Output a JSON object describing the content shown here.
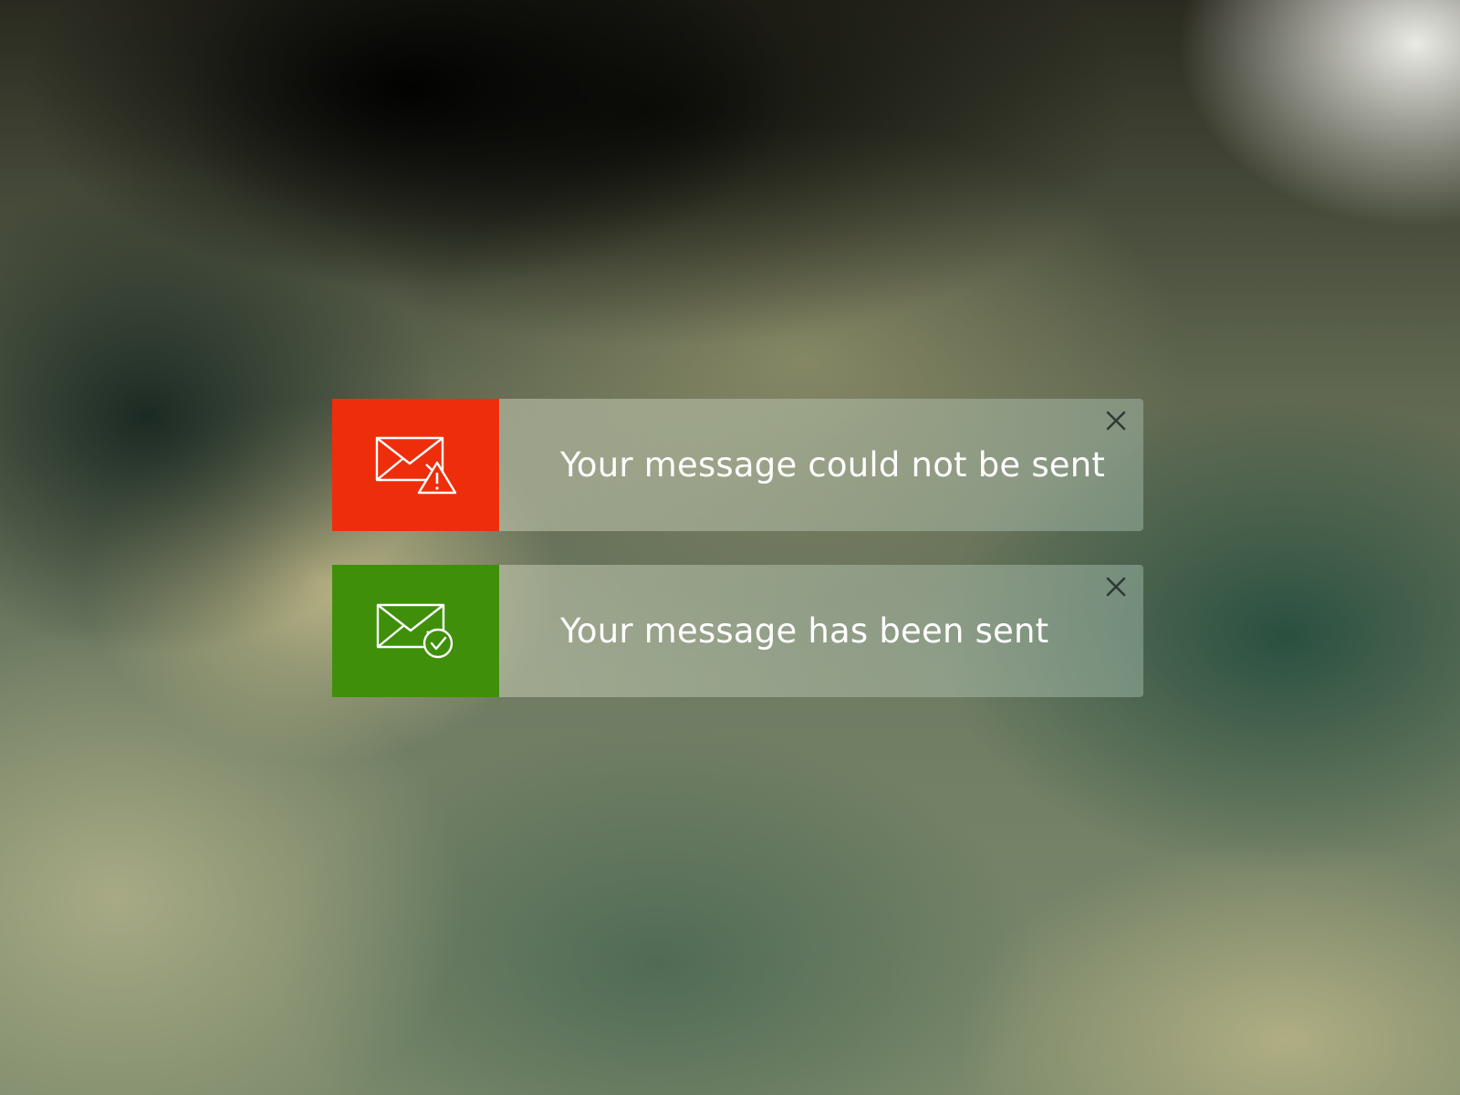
{
  "notifications": [
    {
      "type": "error",
      "message": "Your message could not be sent",
      "icon": "mail-warning-icon",
      "accent_color": "#ee2e0b",
      "close_icon": "close-icon"
    },
    {
      "type": "success",
      "message": "Your message has been sent",
      "icon": "mail-check-icon",
      "accent_color": "#3f8f0b",
      "close_icon": "close-icon"
    }
  ]
}
